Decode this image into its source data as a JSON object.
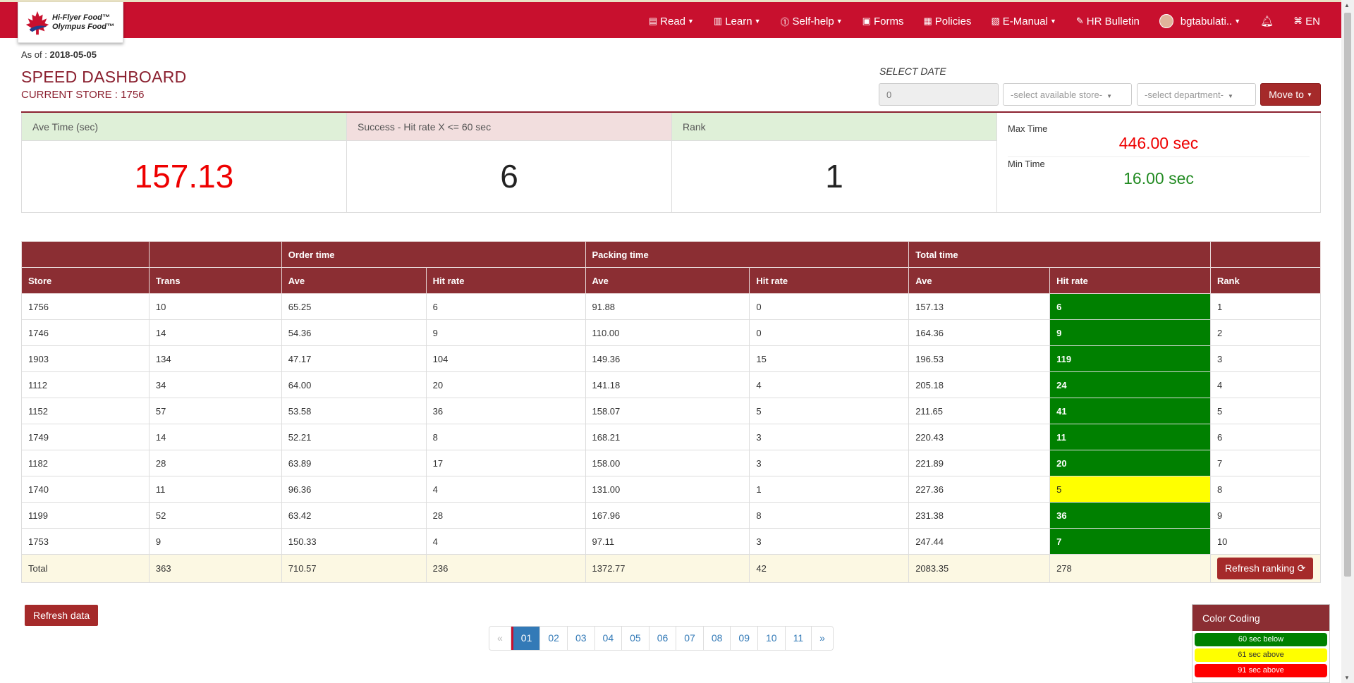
{
  "brand": {
    "line1": "Hi-Flyer Food™",
    "line2": "Olympus Food™"
  },
  "nav": [
    {
      "icon": "book-open-icon",
      "label": "Read"
    },
    {
      "icon": "book-icon",
      "label": "Learn"
    },
    {
      "icon": "help-icon",
      "label": "Self-help"
    },
    {
      "icon": "forms-icon",
      "label": "Forms"
    },
    {
      "icon": "policies-icon",
      "label": "Policies"
    },
    {
      "icon": "manual-icon",
      "label": "E-Manual"
    },
    {
      "icon": "pin-icon",
      "label": "HR Bulletin"
    }
  ],
  "user": {
    "name": "bgtabulati.."
  },
  "lang": "EN",
  "asof": {
    "label": "As of :",
    "date": "2018-05-05"
  },
  "page": {
    "title": "SPEED DASHBOARD",
    "store_label": "CURRENT STORE : 1756"
  },
  "filters": {
    "select_date_label": "SELECT DATE",
    "date_value": "0",
    "store_placeholder": "-select available store-",
    "dept_placeholder": "-select department-",
    "move_to": "Move to"
  },
  "kpis": {
    "ave_label": "Ave Time (sec)",
    "ave_value": "157.13",
    "hit_label": "Success - Hit rate X <= 60 sec",
    "hit_value": "6",
    "rank_label": "Rank",
    "rank_value": "1",
    "max_label": "Max Time",
    "max_value": "446.00 sec",
    "min_label": "Min Time",
    "min_value": "16.00 sec"
  },
  "table": {
    "groups": [
      "Order time",
      "Packing time",
      "Total time"
    ],
    "headers": [
      "Store",
      "Trans",
      "Ave",
      "Hit rate",
      "Ave",
      "Hit rate",
      "Ave",
      "Hit rate",
      "Rank"
    ],
    "rows": [
      [
        "1756",
        "10",
        "65.25",
        "6",
        "91.88",
        "0",
        "157.13",
        "6",
        "1"
      ],
      [
        "1746",
        "14",
        "54.36",
        "9",
        "110.00",
        "0",
        "164.36",
        "9",
        "2"
      ],
      [
        "1903",
        "134",
        "47.17",
        "104",
        "149.36",
        "15",
        "196.53",
        "119",
        "3"
      ],
      [
        "1112",
        "34",
        "64.00",
        "20",
        "141.18",
        "4",
        "205.18",
        "24",
        "4"
      ],
      [
        "1152",
        "57",
        "53.58",
        "36",
        "158.07",
        "5",
        "211.65",
        "41",
        "5"
      ],
      [
        "1749",
        "14",
        "52.21",
        "8",
        "168.21",
        "3",
        "220.43",
        "11",
        "6"
      ],
      [
        "1182",
        "28",
        "63.89",
        "17",
        "158.00",
        "3",
        "221.89",
        "20",
        "7"
      ],
      [
        "1740",
        "11",
        "96.36",
        "4",
        "131.00",
        "1",
        "227.36",
        "5",
        "8"
      ],
      [
        "1199",
        "52",
        "63.42",
        "28",
        "167.96",
        "8",
        "231.38",
        "36",
        "9"
      ],
      [
        "1753",
        "9",
        "150.33",
        "4",
        "97.11",
        "3",
        "247.44",
        "7",
        "10"
      ]
    ],
    "row_colors": [
      "green",
      "green",
      "green",
      "green",
      "green",
      "green",
      "green",
      "yellow",
      "green",
      "green"
    ],
    "total": [
      "Total",
      "363",
      "710.57",
      "236",
      "1372.77",
      "42",
      "2083.35",
      "278"
    ],
    "refresh_ranking": "Refresh ranking"
  },
  "refresh_data": "Refresh data",
  "pager": [
    "«",
    "01",
    "02",
    "03",
    "04",
    "05",
    "06",
    "07",
    "08",
    "09",
    "10",
    "11",
    "»"
  ],
  "legend": {
    "title": "Color Coding",
    "items": [
      {
        "label": "60 sec below",
        "color": "#008000"
      },
      {
        "label": "61 sec above",
        "color": "#ffff00"
      },
      {
        "label": "91 sec above",
        "color": "#ff0000"
      }
    ]
  }
}
